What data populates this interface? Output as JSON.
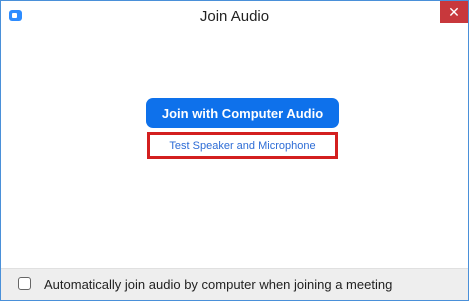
{
  "window": {
    "title": "Join Audio",
    "close_glyph": "✕",
    "app_icon": "zoom-camera-icon"
  },
  "main": {
    "join_button_label": "Join with Computer Audio",
    "test_link_label": "Test Speaker and Microphone"
  },
  "footer": {
    "auto_join_label": "Automatically join audio by computer when joining a meeting",
    "auto_join_checked": false
  },
  "colors": {
    "accent": "#0e71eb",
    "highlight_border": "#d31f1f",
    "link": "#2d6cd6",
    "close": "#c8383c"
  }
}
